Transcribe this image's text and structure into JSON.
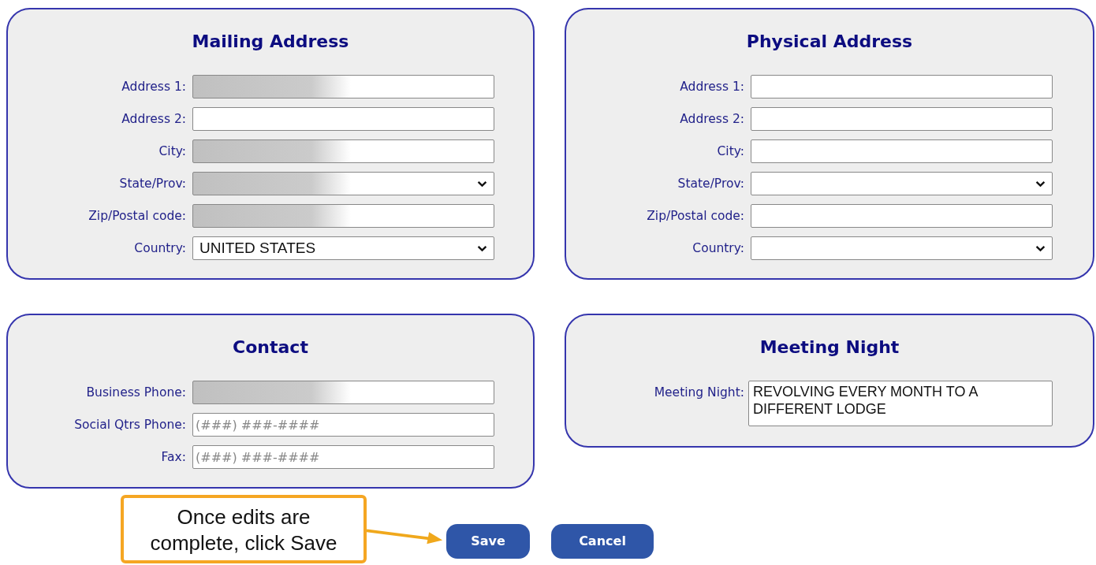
{
  "sections": [
    {
      "title": "Mailing Address",
      "fields": [
        {
          "label": "Address 1:",
          "kind": "text",
          "redacted": true
        },
        {
          "label": "Address 2:",
          "kind": "text",
          "redacted": false
        },
        {
          "label": "City:",
          "kind": "text",
          "redacted": true
        },
        {
          "label": "State/Prov:",
          "kind": "select",
          "redacted": true
        },
        {
          "label": "Zip/Postal code:",
          "kind": "text",
          "redacted": true
        },
        {
          "label": "Country:",
          "kind": "select",
          "redacted": false,
          "value": "UNITED STATES"
        }
      ]
    },
    {
      "title": "Physical Address",
      "fields": [
        {
          "label": "Address 1:",
          "kind": "text",
          "redacted": false
        },
        {
          "label": "Address 2:",
          "kind": "text",
          "redacted": false
        },
        {
          "label": "City:",
          "kind": "text",
          "redacted": false
        },
        {
          "label": "State/Prov:",
          "kind": "select",
          "redacted": false
        },
        {
          "label": "Zip/Postal code:",
          "kind": "text",
          "redacted": false
        },
        {
          "label": "Country:",
          "kind": "select",
          "redacted": false
        }
      ]
    },
    {
      "title": "Contact",
      "fields": [
        {
          "label": "Business Phone:",
          "kind": "text",
          "redacted": true
        },
        {
          "label": "Social Qtrs Phone:",
          "kind": "text",
          "redacted": false,
          "placeholder": "(###) ###-####"
        },
        {
          "label": "Fax:",
          "kind": "text",
          "redacted": false,
          "placeholder": "(###) ###-####"
        }
      ]
    },
    {
      "title": "Meeting Night",
      "fields": [
        {
          "label": "Meeting Night:",
          "kind": "textarea",
          "value": "REVOLVING EVERY MONTH TO A DIFFERENT LODGE"
        }
      ]
    }
  ],
  "callout": {
    "text": "Once edits are complete, click Save"
  },
  "buttons": [
    "Save",
    "Cancel"
  ]
}
